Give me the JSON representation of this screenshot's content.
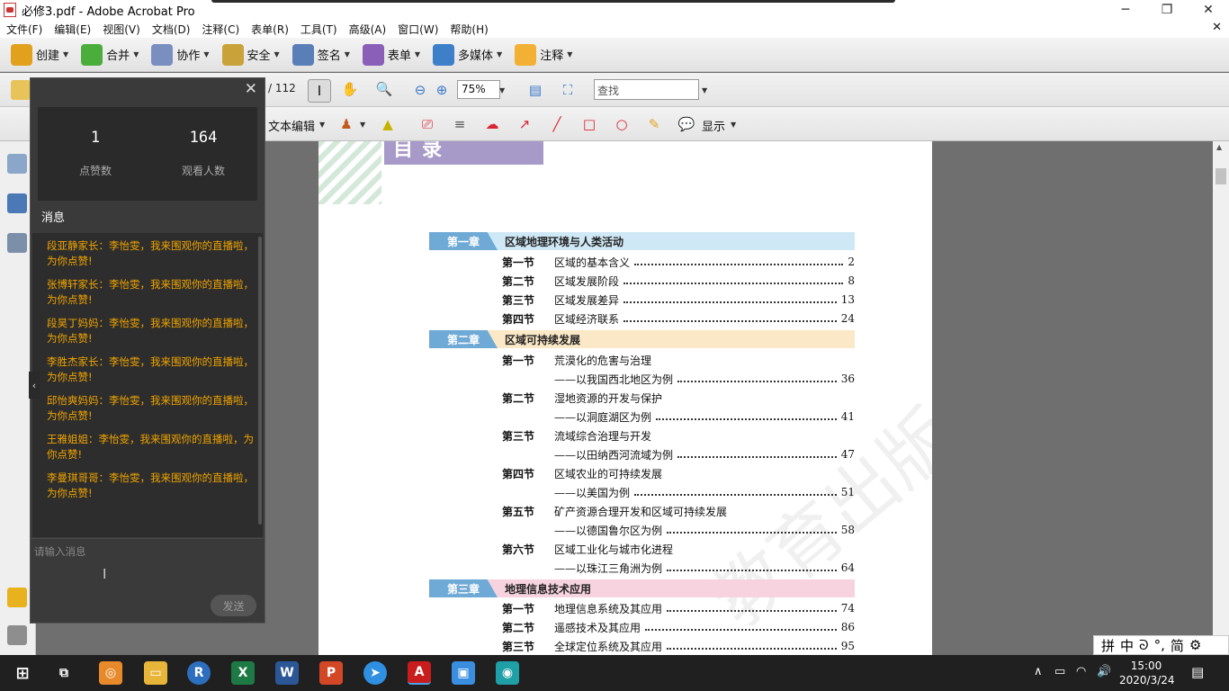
{
  "window": {
    "title": "必修3.pdf - Adobe Acrobat Pro",
    "minimize": "─",
    "restore": "❐",
    "close": "✕"
  },
  "menu": [
    "文件(F)",
    "编辑(E)",
    "视图(V)",
    "文档(D)",
    "注释(C)",
    "表单(R)",
    "工具(T)",
    "高级(A)",
    "窗口(W)",
    "帮助(H)"
  ],
  "menu_close": "✕",
  "toolbar": {
    "items": [
      {
        "label": "创建",
        "color": "#e2a11d"
      },
      {
        "label": "合并",
        "color": "#4bae3c"
      },
      {
        "label": "协作",
        "color": "#7a8fc0"
      },
      {
        "label": "安全",
        "color": "#c9a23a"
      },
      {
        "label": "签名",
        "color": "#5a7fb8"
      },
      {
        "label": "表单",
        "color": "#8a5fb8"
      },
      {
        "label": "多媒体",
        "color": "#3d7fc9"
      },
      {
        "label": "注释",
        "color": "#f2b134"
      }
    ],
    "page_count": "/ 112",
    "zoom": "75%",
    "find_placeholder": "查找",
    "text_edit": "文本编辑",
    "show": "显示"
  },
  "chat": {
    "likes": "1",
    "likes_label": "点赞数",
    "viewers": "164",
    "viewers_label": "观看人数",
    "messages_title": "消息",
    "messages": [
      "段亚静家长：李怡雯，我来围观你的直播啦，为你点赞!",
      "张博轩家长：李怡雯，我来围观你的直播啦，为你点赞!",
      "段昊丁妈妈：李怡雯，我来围观你的直播啦，为你点赞!",
      "李胜杰家长：李怡雯，我来围观你的直播啦，为你点赞!",
      "邱怡爽妈妈：李怡雯，我来围观你的直播啦，为你点赞!",
      "王雅姐姐：李怡雯，我来围观你的直播啦，为你点赞!",
      "李曼琪哥哥：李怡雯，我来围观你的直播啦，为你点赞!"
    ],
    "input_placeholder": "请输入消息",
    "send": "发送",
    "message_color": "#f0a400"
  },
  "pdf": {
    "heading": "目录",
    "chapters": [
      {
        "tag": "第一章",
        "name": "区域地理环境与人类活动",
        "bg": "#cfe8f5",
        "tag_bg": "#6fa9d6"
      },
      {
        "tag": "第二章",
        "name": "区域可持续发展",
        "bg": "#fbe8c6",
        "tag_bg": "#6fa9d6"
      },
      {
        "tag": "第三章",
        "name": "地理信息技术应用",
        "bg": "#f7d3e0",
        "tag_bg": "#6fa9d6"
      }
    ],
    "sections": [
      {
        "no": "第一节",
        "title": "区域的基本含义",
        "page": "2"
      },
      {
        "no": "第二节",
        "title": "区域发展阶段",
        "page": "8"
      },
      {
        "no": "第三节",
        "title": "区域发展差异",
        "page": "13"
      },
      {
        "no": "第四节",
        "title": "区域经济联系",
        "page": "24"
      },
      {
        "no": "第一节",
        "title": "荒漠化的危害与治理",
        "page": ""
      },
      {
        "no": "",
        "title": "——以我国西北地区为例",
        "page": "36"
      },
      {
        "no": "第二节",
        "title": "湿地资源的开发与保护",
        "page": ""
      },
      {
        "no": "",
        "title": "——以洞庭湖区为例",
        "page": "41"
      },
      {
        "no": "第三节",
        "title": "流域综合治理与开发",
        "page": ""
      },
      {
        "no": "",
        "title": "——以田纳西河流域为例",
        "page": "47"
      },
      {
        "no": "第四节",
        "title": "区域农业的可持续发展",
        "page": ""
      },
      {
        "no": "",
        "title": "——以美国为例",
        "page": "51"
      },
      {
        "no": "第五节",
        "title": "矿产资源合理开发和区域可持续发展",
        "page": ""
      },
      {
        "no": "",
        "title": "——以德国鲁尔区为例",
        "page": "58"
      },
      {
        "no": "第六节",
        "title": "区域工业化与城市化进程",
        "page": ""
      },
      {
        "no": "",
        "title": "——以珠江三角洲为例",
        "page": "64"
      },
      {
        "no": "第一节",
        "title": "地理信息系统及其应用",
        "page": "74"
      },
      {
        "no": "第二节",
        "title": "遥感技术及其应用",
        "page": "86"
      },
      {
        "no": "第三节",
        "title": "全球定位系统及其应用",
        "page": "95"
      }
    ],
    "watermark": "教育出版社"
  },
  "ime": [
    "拼",
    "中",
    "ᘐ",
    "°,",
    "简",
    "⚙"
  ],
  "taskbar": {
    "apps": [
      {
        "name": "task-view",
        "glyph": "⧉",
        "color": "#202020"
      },
      {
        "name": "chrome-like",
        "glyph": "◎",
        "color": "#e8892a"
      },
      {
        "name": "file-explorer",
        "glyph": "▭",
        "color": "#e7b53a"
      },
      {
        "name": "r-app",
        "glyph": "R",
        "color": "#2d6fbf"
      },
      {
        "name": "excel",
        "glyph": "X",
        "color": "#1d7a44"
      },
      {
        "name": "word",
        "glyph": "W",
        "color": "#2b5797"
      },
      {
        "name": "powerpoint",
        "glyph": "P",
        "color": "#d24726"
      },
      {
        "name": "feishu",
        "glyph": "➤",
        "color": "#2f8fe0"
      },
      {
        "name": "acrobat",
        "glyph": "A",
        "color": "#c91c1c"
      },
      {
        "name": "camera-app",
        "glyph": "▣",
        "color": "#3a8ee0"
      },
      {
        "name": "video-meeting",
        "glyph": "◉",
        "color": "#1f9fa6"
      }
    ],
    "time": "15:00",
    "date": "2020/3/24"
  }
}
